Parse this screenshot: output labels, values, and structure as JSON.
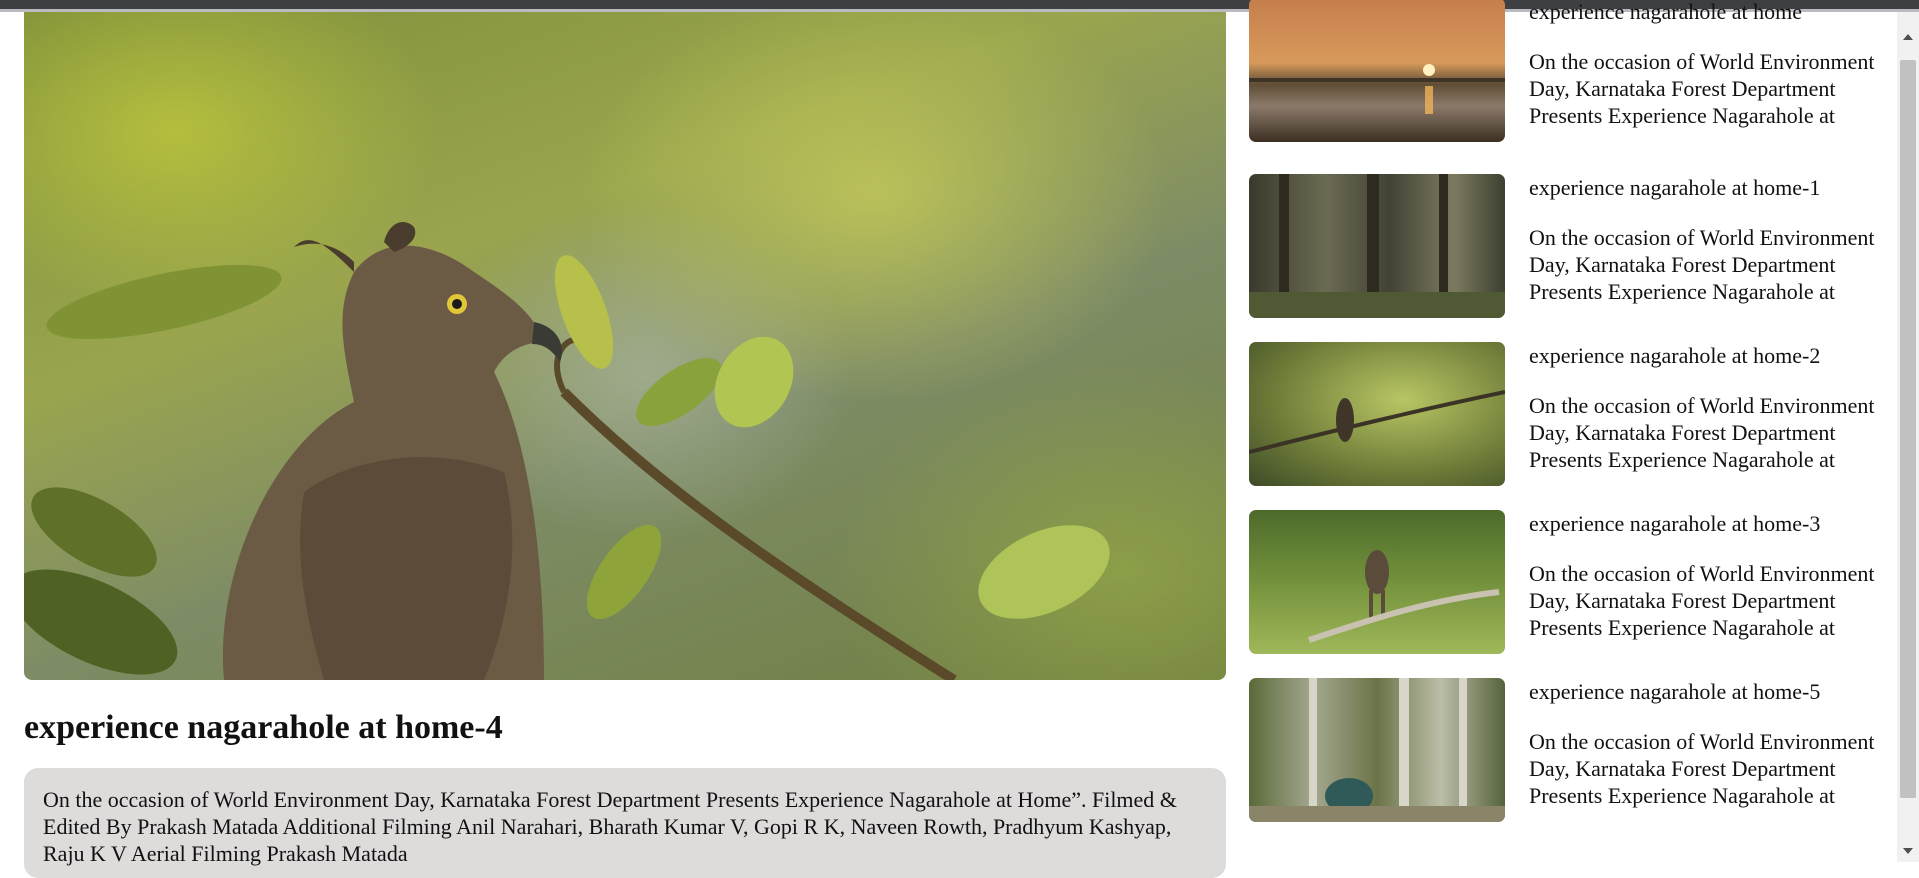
{
  "main": {
    "title": "experience nagarahole at home-4",
    "description": "On the occasion of World Environment Day, Karnataka Forest Department Presents Experience Nagarahole at Home”. Filmed & Edited By Prakash Matada Additional Filming Anil Narahari, Bharath Kumar V, Gopi R K, Naveen Rowth, Pradhyum Kashyap, Raju K V Aerial Filming Prakash Matada"
  },
  "playlist": [
    {
      "title": "experience nagarahole at home",
      "description": "On the occasion of World Environment Day, Karnataka Forest Department Presents Experience Nagarahole at Home”."
    },
    {
      "title": "experience nagarahole at home-1",
      "description": "On the occasion of World Environment Day, Karnataka Forest Department Presents Experience Nagarahole at Home”."
    },
    {
      "title": "experience nagarahole at home-2",
      "description": "On the occasion of World Environment Day, Karnataka Forest Department Presents Experience Nagarahole at Home”."
    },
    {
      "title": "experience nagarahole at home-3",
      "description": "On the occasion of World Environment Day, Karnataka Forest Department Presents Experience Nagarahole at Home”."
    },
    {
      "title": "experience nagarahole at home-5",
      "description": "On the occasion of World Environment Day, Karnataka Forest Department Presents Experience Nagarahole at Home”."
    }
  ]
}
